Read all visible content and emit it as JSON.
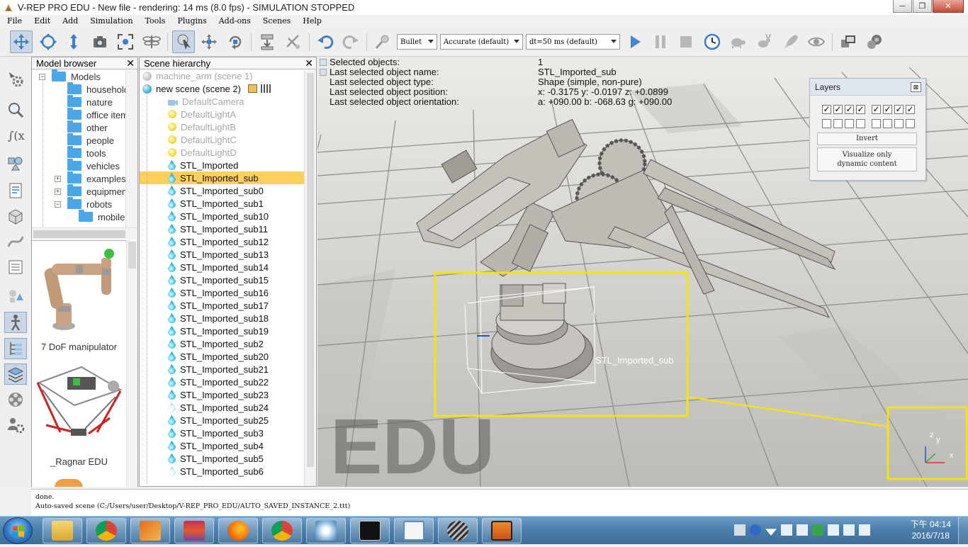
{
  "window": {
    "title": "V-REP PRO EDU - New file - rendering: 14 ms (8.0 fps) - SIMULATION STOPPED",
    "minimize": "─",
    "maximize": "❐",
    "close": "✕"
  },
  "menu": [
    "File",
    "Edit",
    "Add",
    "Simulation",
    "Tools",
    "Plugins",
    "Add-ons",
    "Scenes",
    "Help"
  ],
  "toolbar": {
    "engine": "Bullet",
    "accuracy": "Accurate (default)",
    "timestep": "dt=50 ms (default)"
  },
  "model_browser": {
    "title": "Model browser",
    "close": "✕",
    "tree": [
      {
        "label": "Models",
        "level": 0,
        "expander": "−"
      },
      {
        "label": "household",
        "level": 1
      },
      {
        "label": "nature",
        "level": 1
      },
      {
        "label": "office items",
        "level": 1
      },
      {
        "label": "other",
        "level": 1
      },
      {
        "label": "people",
        "level": 1
      },
      {
        "label": "tools",
        "level": 1
      },
      {
        "label": "vehicles",
        "level": 1
      },
      {
        "label": "examples",
        "level": 1,
        "expander": "+"
      },
      {
        "label": "equipment",
        "level": 1,
        "expander": "+"
      },
      {
        "label": "robots",
        "level": 1,
        "expander": "−"
      },
      {
        "label": "mobile",
        "level": 2
      }
    ],
    "thumbnails": [
      "7 DoF manipulator",
      "_Ragnar EDU"
    ]
  },
  "scene_hierarchy": {
    "title": "Scene hierarchy",
    "close": "✕",
    "scenes": [
      {
        "label": "machine_arm (scene 1)",
        "active": false
      },
      {
        "label": "new scene (scene 2)",
        "active": true
      }
    ],
    "items": [
      {
        "label": "DefaultCamera",
        "icon": "camera",
        "dim": true
      },
      {
        "label": "DefaultLightA",
        "icon": "light",
        "dim": true
      },
      {
        "label": "DefaultLightB",
        "icon": "light",
        "dim": true
      },
      {
        "label": "DefaultLightC",
        "icon": "light",
        "dim": true
      },
      {
        "label": "DefaultLightD",
        "icon": "light",
        "dim": true
      },
      {
        "label": "STL_Imported",
        "icon": "shape"
      },
      {
        "label": "STL_Imported_sub",
        "icon": "shape",
        "selected": true
      },
      {
        "label": "STL_Imported_sub0",
        "icon": "shape"
      },
      {
        "label": "STL_Imported_sub1",
        "icon": "shape"
      },
      {
        "label": "STL_Imported_sub10",
        "icon": "shape"
      },
      {
        "label": "STL_Imported_sub11",
        "icon": "shape"
      },
      {
        "label": "STL_Imported_sub12",
        "icon": "shape"
      },
      {
        "label": "STL_Imported_sub13",
        "icon": "shape"
      },
      {
        "label": "STL_Imported_sub14",
        "icon": "shape"
      },
      {
        "label": "STL_Imported_sub15",
        "icon": "shape"
      },
      {
        "label": "STL_Imported_sub16",
        "icon": "shape"
      },
      {
        "label": "STL_Imported_sub17",
        "icon": "shape"
      },
      {
        "label": "STL_Imported_sub18",
        "icon": "shape"
      },
      {
        "label": "STL_Imported_sub19",
        "icon": "shape"
      },
      {
        "label": "STL_Imported_sub2",
        "icon": "shape"
      },
      {
        "label": "STL_Imported_sub20",
        "icon": "shape"
      },
      {
        "label": "STL_Imported_sub21",
        "icon": "shape"
      },
      {
        "label": "STL_Imported_sub22",
        "icon": "shape"
      },
      {
        "label": "STL_Imported_sub23",
        "icon": "shape"
      },
      {
        "label": "STL_Imported_sub24",
        "icon": "shape",
        "pale": true
      },
      {
        "label": "STL_Imported_sub25",
        "icon": "shape"
      },
      {
        "label": "STL_Imported_sub3",
        "icon": "shape"
      },
      {
        "label": "STL_Imported_sub4",
        "icon": "shape"
      },
      {
        "label": "STL_Imported_sub5",
        "icon": "shape"
      },
      {
        "label": "STL_Imported_sub6",
        "icon": "shape",
        "pale": true
      }
    ]
  },
  "object_info": {
    "labels": [
      "Selected objects:",
      "Last selected object name:",
      "Last selected object type:",
      "Last selected object position:",
      "Last selected object orientation:"
    ],
    "values": [
      "1",
      "STL_Imported_sub",
      "Shape (simple, non-pure)",
      "x: -0.3175    y: -0.0197    z: +0.0899",
      "a: +090.00    b: -068.63    g: +090.00"
    ]
  },
  "viewport": {
    "selection_label": "STL_Imported_sub",
    "watermark": "EDU",
    "axes": {
      "x": "x",
      "y": "y",
      "z": "z"
    },
    "highlight_color": "#f2e21a"
  },
  "layers_dialog": {
    "title": "Layers",
    "close": "⊠",
    "row1": [
      true,
      true,
      true,
      true,
      true,
      true,
      true,
      true
    ],
    "row2": [
      false,
      false,
      false,
      false,
      false,
      false,
      false,
      false
    ],
    "invert_label": "Invert",
    "visualize_label_1": "Visualize only",
    "visualize_label_2": "dynamic content"
  },
  "status": {
    "line1": "done.",
    "line2": "Auto-saved scene (C:/Users/user/Desktop/V-REP_PRO_EDU/AUTO_SAVED_INSTANCE_2.ttt)"
  },
  "taskbar": {
    "time": "下午 04:14",
    "date": "2016/7/18",
    "apps": [
      "file-explorer",
      "chrome",
      "v-rep",
      "rar",
      "firefox",
      "chrome",
      "paint",
      "cmd",
      "window",
      "sphere-app",
      "tiger-app"
    ]
  }
}
